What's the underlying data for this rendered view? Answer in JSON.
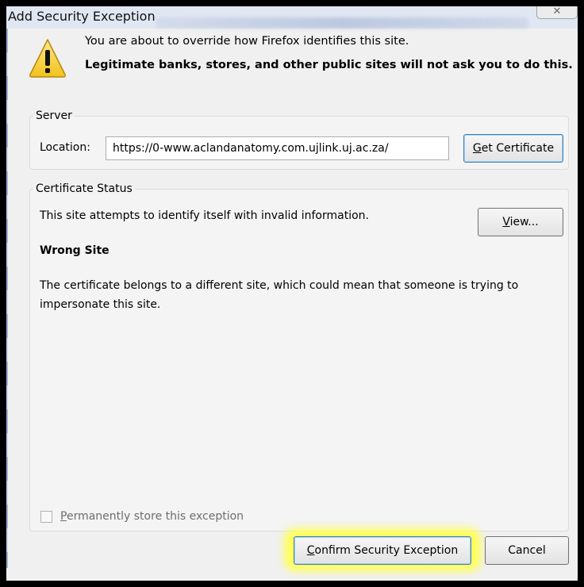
{
  "window": {
    "title": "Add Security Exception",
    "close_glyph": "✕"
  },
  "message": {
    "icon": "warning-icon",
    "line1": "You are about to override how Firefox identifies this site.",
    "line2": "Legitimate banks, stores, and other public sites will not ask you to do this."
  },
  "server": {
    "legend": "Server",
    "location_label": "Location:",
    "location_value": "https://0-www.aclandanatomy.com.ujlink.uj.ac.za/",
    "get_certificate": {
      "mnemonic": "G",
      "rest": "et Certificate"
    }
  },
  "certificate_status": {
    "legend": "Certificate Status",
    "summary": "This site attempts to identify itself with invalid information.",
    "view_button": {
      "mnemonic": "V",
      "rest": "iew..."
    },
    "problem_title": "Wrong Site",
    "problem_line1": "The certificate belongs to a different site, which could mean that someone is trying to",
    "problem_line2": "impersonate this site."
  },
  "permanent": {
    "checked": false,
    "mnemonic": "P",
    "rest": "ermanently store this exception"
  },
  "buttons": {
    "confirm": {
      "mnemonic": "C",
      "rest": "onfirm Security Exception"
    },
    "cancel": "Cancel"
  },
  "colors": {
    "highlight": "#ffff5a",
    "warning_fill": "#f5d430",
    "focus_border": "#3c7fb1"
  }
}
